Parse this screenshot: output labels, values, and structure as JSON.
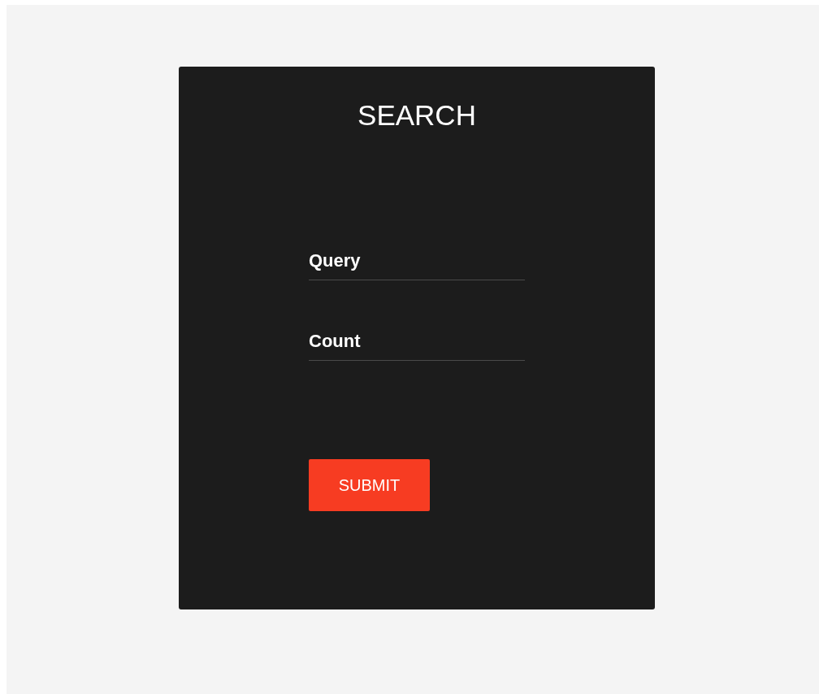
{
  "form": {
    "title": "SEARCH",
    "fields": [
      {
        "placeholder": "Query"
      },
      {
        "placeholder": "Count"
      }
    ],
    "submit_button": "SUBMIT"
  }
}
